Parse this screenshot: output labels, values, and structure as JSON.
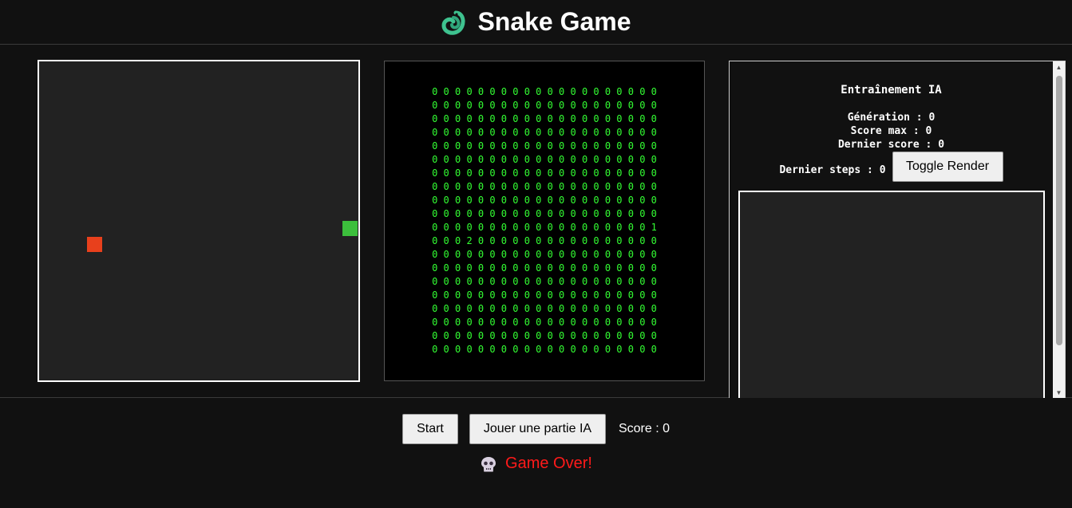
{
  "header": {
    "title": "Snake Game",
    "logo_icon": "snake-icon"
  },
  "game_board": {
    "grid_size": 20,
    "background": "#222222",
    "food": {
      "row": 11,
      "col": 3,
      "color": "#e8401c"
    },
    "snake": [
      {
        "row": 10,
        "col": 19
      }
    ],
    "snake_color": "#3cbf3c"
  },
  "matrix_view": {
    "color": "#33ff33",
    "rows": [
      "0 0 0 0 0 0 0 0 0 0 0 0 0 0 0 0 0 0 0 0",
      "0 0 0 0 0 0 0 0 0 0 0 0 0 0 0 0 0 0 0 0",
      "0 0 0 0 0 0 0 0 0 0 0 0 0 0 0 0 0 0 0 0",
      "0 0 0 0 0 0 0 0 0 0 0 0 0 0 0 0 0 0 0 0",
      "0 0 0 0 0 0 0 0 0 0 0 0 0 0 0 0 0 0 0 0",
      "0 0 0 0 0 0 0 0 0 0 0 0 0 0 0 0 0 0 0 0",
      "0 0 0 0 0 0 0 0 0 0 0 0 0 0 0 0 0 0 0 0",
      "0 0 0 0 0 0 0 0 0 0 0 0 0 0 0 0 0 0 0 0",
      "0 0 0 0 0 0 0 0 0 0 0 0 0 0 0 0 0 0 0 0",
      "0 0 0 0 0 0 0 0 0 0 0 0 0 0 0 0 0 0 0 0",
      "0 0 0 0 0 0 0 0 0 0 0 0 0 0 0 0 0 0 0 1",
      "0 0 0 2 0 0 0 0 0 0 0 0 0 0 0 0 0 0 0 0",
      "0 0 0 0 0 0 0 0 0 0 0 0 0 0 0 0 0 0 0 0",
      "0 0 0 0 0 0 0 0 0 0 0 0 0 0 0 0 0 0 0 0",
      "0 0 0 0 0 0 0 0 0 0 0 0 0 0 0 0 0 0 0 0",
      "0 0 0 0 0 0 0 0 0 0 0 0 0 0 0 0 0 0 0 0",
      "0 0 0 0 0 0 0 0 0 0 0 0 0 0 0 0 0 0 0 0",
      "0 0 0 0 0 0 0 0 0 0 0 0 0 0 0 0 0 0 0 0",
      "0 0 0 0 0 0 0 0 0 0 0 0 0 0 0 0 0 0 0 0",
      "0 0 0 0 0 0 0 0 0 0 0 0 0 0 0 0 0 0 0 0"
    ]
  },
  "ai_panel": {
    "title": "Entraînement IA",
    "generation": "Génération : 0",
    "max_score": "Score max : 0",
    "last_score": "Dernier score : 0",
    "last_steps": "Dernier steps : 0",
    "toggle_label": "Toggle Render"
  },
  "controls": {
    "start_label": "Start",
    "play_ai_label": "Jouer une partie IA",
    "score": "Score : 0"
  },
  "status": {
    "icon": "skull-icon",
    "message": "Game Over!",
    "color": "#ff1a1a"
  }
}
